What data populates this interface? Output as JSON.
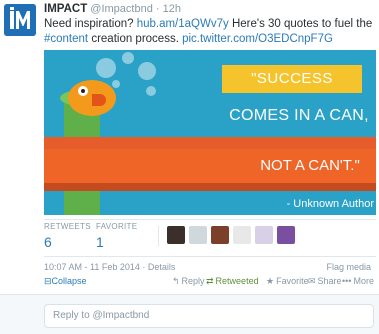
{
  "tweet": {
    "name": "IMPACT",
    "handle": "@Impactbnd",
    "separator": "·",
    "time": "12h",
    "text_start": "Need inspiration? ",
    "link1": "hub.am/1aQWv7y",
    "text_mid": " Here's 30 quotes to fuel the ",
    "hashtag": "#content",
    "text_end": " creation process. ",
    "link2": "pic.twitter.com/O3EDCnpF7G"
  },
  "media": {
    "line1": "\"SUCCESS",
    "line2": "COMES IN A CAN,",
    "line3": "NOT A CAN'T.\"",
    "author": "- Unknown Author"
  },
  "stats": {
    "retweets_label": "RETWEETS",
    "retweets_value": "6",
    "favorites_label": "FAVORITE",
    "favorites_value": "1"
  },
  "meta": {
    "timestamp": "10:07 AM - 11 Feb 2014 · Details",
    "flag": "Flag media"
  },
  "actions": {
    "collapse": "Collapse",
    "reply": "Reply",
    "retweeted": "Retweeted",
    "favorite": "Favorite",
    "share": "Share",
    "more": "More"
  },
  "reply": {
    "placeholder": "Reply to @Impactbnd"
  },
  "colors": {
    "link": "#2b7bb9",
    "retweeted": "#5c913b",
    "media_bg": "#2aa1c7",
    "yellow": "#f5c32c",
    "orange": "#ef6528"
  }
}
